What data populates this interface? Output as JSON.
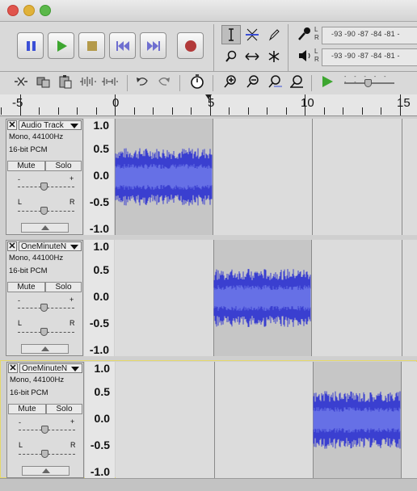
{
  "toolbar": {
    "colors": {
      "accent": "#3b4fd6",
      "record": "#b23a3a",
      "play": "#3da630"
    },
    "transport": [
      "pause-icon",
      "play-icon",
      "stop-icon",
      "skip-to-start-icon",
      "skip-to-end-icon",
      "record-icon"
    ],
    "tools": [
      "selection-tool-icon",
      "envelope-tool-icon",
      "draw-tool-icon",
      "zoom-tool-icon",
      "time-shift-tool-icon",
      "multi-tool-icon"
    ],
    "meter_record_labels": "-93 -90 -87 -84 -81 -",
    "meter_play_labels": "-93 -90 -87 -84 -81 -",
    "meter_channel_l": "L",
    "meter_channel_r": "R"
  },
  "ruler": {
    "labels": [
      "-5",
      "0",
      "5",
      "10",
      "15"
    ]
  },
  "tracks": [
    {
      "name": "Audio Track",
      "format": "Mono, 44100Hz",
      "bitdepth": "16-bit PCM",
      "mute": "Mute",
      "solo": "Solo",
      "gain_minus": "-",
      "gain_plus": "+",
      "pan_l": "L",
      "pan_r": "R",
      "clip_start_s": 0,
      "clip_end_s": 5.2
    },
    {
      "name": "OneMinuteN",
      "format": "Mono, 44100Hz",
      "bitdepth": "16-bit PCM",
      "mute": "Mute",
      "solo": "Solo",
      "gain_minus": "-",
      "gain_plus": "+",
      "pan_l": "L",
      "pan_r": "R",
      "clip_start_s": 5.2,
      "clip_end_s": 10.4
    },
    {
      "name": "OneMinuteN",
      "format": "Mono, 44100Hz",
      "bitdepth": "16-bit PCM",
      "mute": "Mute",
      "solo": "Solo",
      "gain_minus": "-",
      "gain_plus": "+",
      "pan_l": "L",
      "pan_r": "R",
      "clip_start_s": 10.4,
      "clip_end_s": 15.1
    }
  ],
  "vruler_labels": [
    "1.0",
    "0.5",
    "0.0",
    "-0.5",
    "-1.0"
  ]
}
